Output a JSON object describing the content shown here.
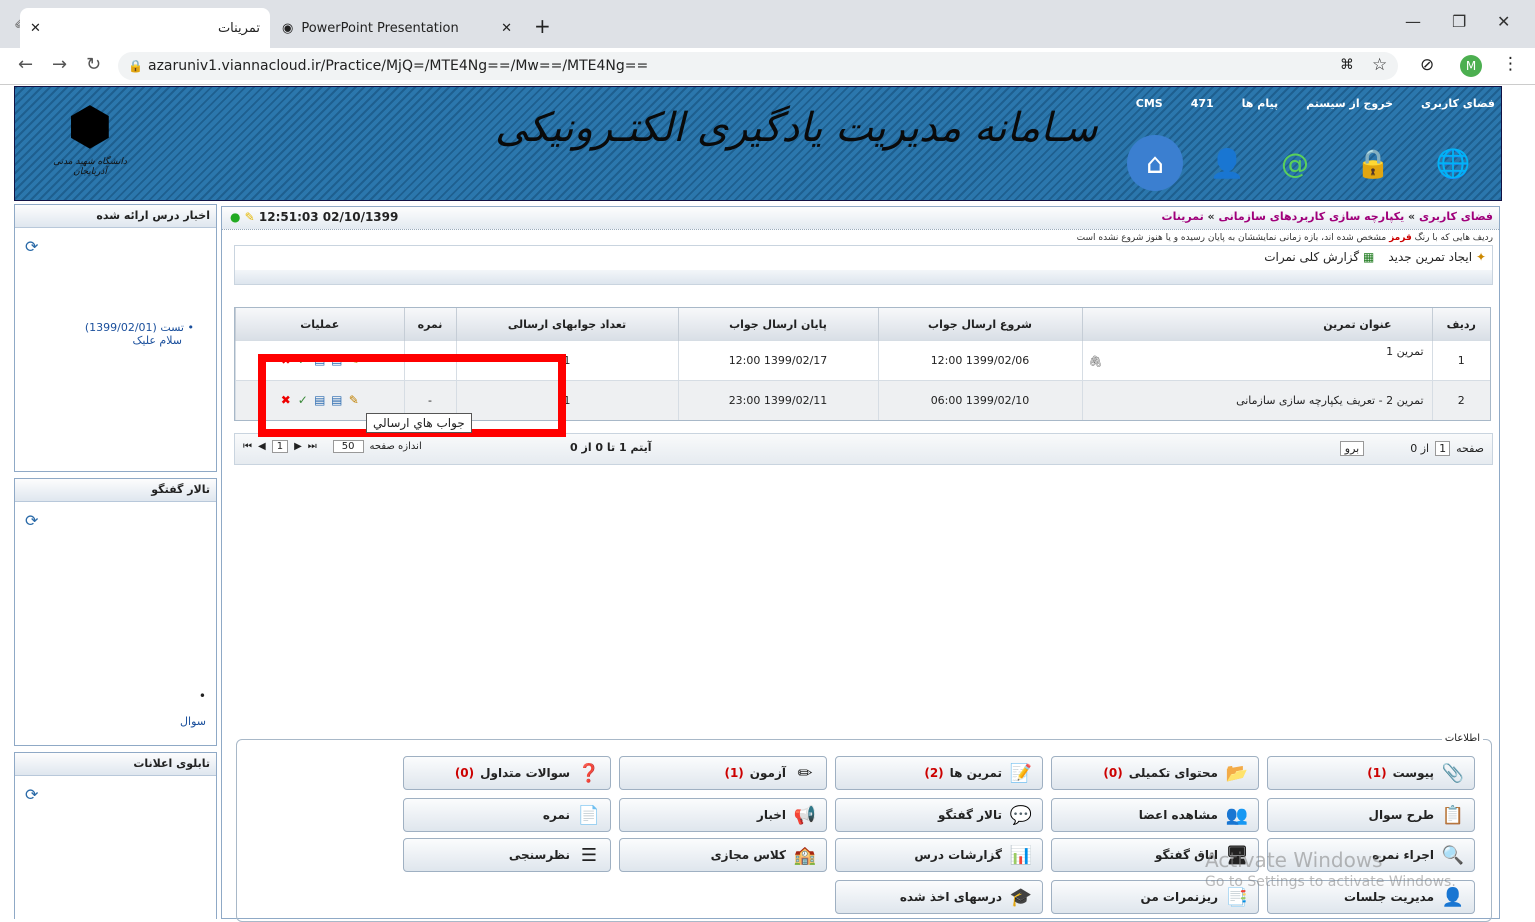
{
  "browser": {
    "tabs": [
      {
        "title": "تمرینات",
        "active": true
      },
      {
        "title": "PowerPoint Presentation",
        "active": false
      }
    ],
    "url": "azaruniv1.viannacloud.ir/Practice/MjQ=/MTE4Ng==/Mw==/MTE4Ng==",
    "profile_initial": "M"
  },
  "header": {
    "title": "سـامانه مدیریت یادگیری الکتـرونیکی",
    "logo_caption": "دانشگاه شهید مدنی آذربایجان",
    "links": {
      "workspace": "فضای کاربری",
      "logout": "خروج از سیستم",
      "messages": "پیام ها",
      "count": "471",
      "cms": "CMS"
    }
  },
  "sidebar": {
    "news": {
      "title": "اخبار درس ارائه شده",
      "items": [
        {
          "text": "تست (1399/02/01)",
          "sub": "سلام علیک"
        }
      ]
    },
    "forum": {
      "title": "تالار گفتگو",
      "link": "سوال"
    },
    "board": {
      "title": "تابلوی اعلانات"
    }
  },
  "main": {
    "clock": "12:51:03 02/10/1399",
    "breadcrumbs": [
      "فضای کاربری",
      "یکپارچه سازی کاربردهای سازمانی",
      "تمرینات"
    ],
    "note_before": "ردیف هایی که با رنگ",
    "note_red": "قرمز",
    "note_after": "مشخص شده اند، بازه زمانی نمایششان به پایان رسیده و یا هنوز شروع نشده است",
    "actions": {
      "create": "ایجاد تمرین جدید",
      "report": "گزارش کلی نمرات"
    },
    "table": {
      "headers": [
        "ردیف",
        "عنوان تمرین",
        "شروع ارسال جواب",
        "پایان ارسال جواب",
        "تعداد جوابهای ارسالی",
        "نمره",
        "عملیات"
      ],
      "rows": [
        {
          "num": "1",
          "title": "تمرین 1",
          "start": "1399/02/06 12:00",
          "end": "1399/02/17 12:00",
          "count": "1",
          "grade": ""
        },
        {
          "num": "2",
          "title": "تمرین 2 - تعریف یکپارچه سازی سازمانی",
          "start": "1399/02/10 06:00",
          "end": "1399/02/11 23:00",
          "count": "1",
          "grade": "-"
        }
      ]
    },
    "tooltip": "جواب هاي ارسالي",
    "pager": {
      "page_label": "صفحه",
      "page": "1",
      "of_text": "از 0",
      "go": "برو",
      "items_text": "آیتم 1 تا 0 از 0",
      "per_page": "50",
      "per_page_label": "اندازه صفحه",
      "current": "1"
    }
  },
  "info": {
    "legend": "اطلاعات",
    "buttons": [
      {
        "label": "پیوست",
        "count": "(1)",
        "icon": "📎"
      },
      {
        "label": "محتوای تکمیلی",
        "count": "(0)",
        "icon": "📂"
      },
      {
        "label": "تمرین ها",
        "count": "(2)",
        "icon": "📝"
      },
      {
        "label": "آزمون",
        "count": "(1)",
        "icon": "✏"
      },
      {
        "label": "سوالات متداول",
        "count": "(0)",
        "icon": "❓"
      },
      {
        "label": "طرح سوال",
        "count": "",
        "icon": "📋"
      },
      {
        "label": "مشاهده اعضا",
        "count": "",
        "icon": "👥"
      },
      {
        "label": "تالار گفتگو",
        "count": "",
        "icon": "💬"
      },
      {
        "label": "اخبار",
        "count": "",
        "icon": "📢"
      },
      {
        "label": "نمره",
        "count": "",
        "icon": "📄"
      },
      {
        "label": "اجراء نمره",
        "count": "",
        "icon": "🔍"
      },
      {
        "label": "اتاق گفتگو",
        "count": "",
        "icon": "🖥"
      },
      {
        "label": "گزارشات درس",
        "count": "",
        "icon": "📊"
      },
      {
        "label": "کلاس مجازی",
        "count": "",
        "icon": "🏫"
      },
      {
        "label": "نظرسنجی",
        "count": "",
        "icon": "☰"
      },
      {
        "label": "مدیریت جلسات",
        "count": "",
        "icon": "👤"
      },
      {
        "label": "ریزنمرات من",
        "count": "",
        "icon": "📑"
      },
      {
        "label": "درسهای اخذ شده",
        "count": "",
        "icon": "🎓"
      }
    ]
  },
  "watermark": {
    "line1": "Activate Windows",
    "line2": "Go to Settings to activate Windows."
  },
  "colors": {
    "banner": "#2b77ad",
    "breadcrumb": "#a0007a",
    "highlight": "#ff0000"
  }
}
